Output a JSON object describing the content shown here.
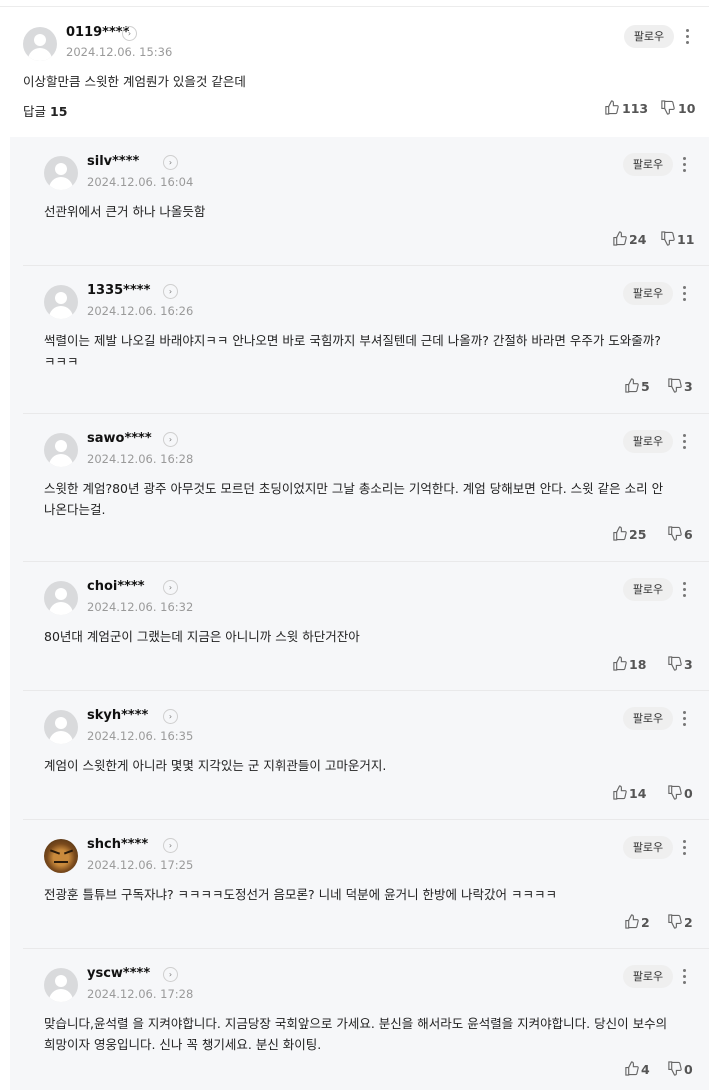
{
  "main_comment": {
    "username": "0119****",
    "date": "2024.12.06. 15:36",
    "text": "이상할만큼 스윗한 계엄뤈가 있을것 같은데",
    "follow_label": "팔로우",
    "reply_label": "답글",
    "reply_count": "15",
    "likes": "113",
    "dislikes": "10"
  },
  "replies": [
    {
      "username": "silv****",
      "date": "2024.12.06. 16:04",
      "text": "선관위에서 큰거 하나 나올듯함",
      "follow_label": "팔로우",
      "likes": "24",
      "dislikes": "11"
    },
    {
      "username": "1335****",
      "date": "2024.12.06. 16:26",
      "text": "썩렬이는 제발 나오길 바래야지ㅋㅋ 안나오면 바로 국힘까지 부셔질텐데 근데 나올까? 간절하 바라면 우주가 도와줄까? ㅋㅋㅋ",
      "follow_label": "팔로우",
      "likes": "5",
      "dislikes": "3"
    },
    {
      "username": "sawo****",
      "date": "2024.12.06. 16:28",
      "text": "스윗한 계엄?80년 광주 아무것도 모르던 초딩이었지만 그날 총소리는 기억한다. 계엄 당해보면 안다. 스윗 같은 소리 안 나온다는걸.",
      "follow_label": "팔로우",
      "likes": "25",
      "dislikes": "6"
    },
    {
      "username": "choi****",
      "date": "2024.12.06. 16:32",
      "text": "80년대 계엄군이 그랬는데 지금은 아니니까 스윗 하단거잔아",
      "follow_label": "팔로우",
      "likes": "18",
      "dislikes": "3"
    },
    {
      "username": "skyh****",
      "date": "2024.12.06. 16:35",
      "text": "계엄이 스윗한게 아니라 몇몇 지각있는 군 지휘관들이 고마운거지.",
      "follow_label": "팔로우",
      "likes": "14",
      "dislikes": "0"
    },
    {
      "username": "shch****",
      "date": "2024.12.06. 17:25",
      "text": "전광훈 틀튜브 구독자냐? ㅋㅋㅋㅋ도정선거 음모론? 니네 덕분에 윤거니 한방에 나락갔어 ㅋㅋㅋㅋ",
      "follow_label": "팔로우",
      "likes": "2",
      "dislikes": "2",
      "avatar": "tiger-photo"
    },
    {
      "username": "yscw****",
      "date": "2024.12.06. 17:28",
      "text": "맞습니다,윤석렬 을 지켜야합니다. 지금당장 국회앞으로 가세요. 분신을 해서라도 윤석렬을 지켜야합니다. 당신이 보수의 희망이자 영웅입니다. 신나 꼭 챙기세요. 분신 화이팅.",
      "follow_label": "팔로우",
      "likes": "4",
      "dislikes": "0"
    }
  ],
  "icons": {
    "profile_arrow": "chevron-right-icon",
    "more": "more-vertical-icon",
    "like": "thumbs-up-icon",
    "dislike": "thumbs-down-icon"
  },
  "colors": {
    "reply_background": "#f6f7f9",
    "follow_background": "#efefef",
    "date_text": "#9a9a9a"
  }
}
